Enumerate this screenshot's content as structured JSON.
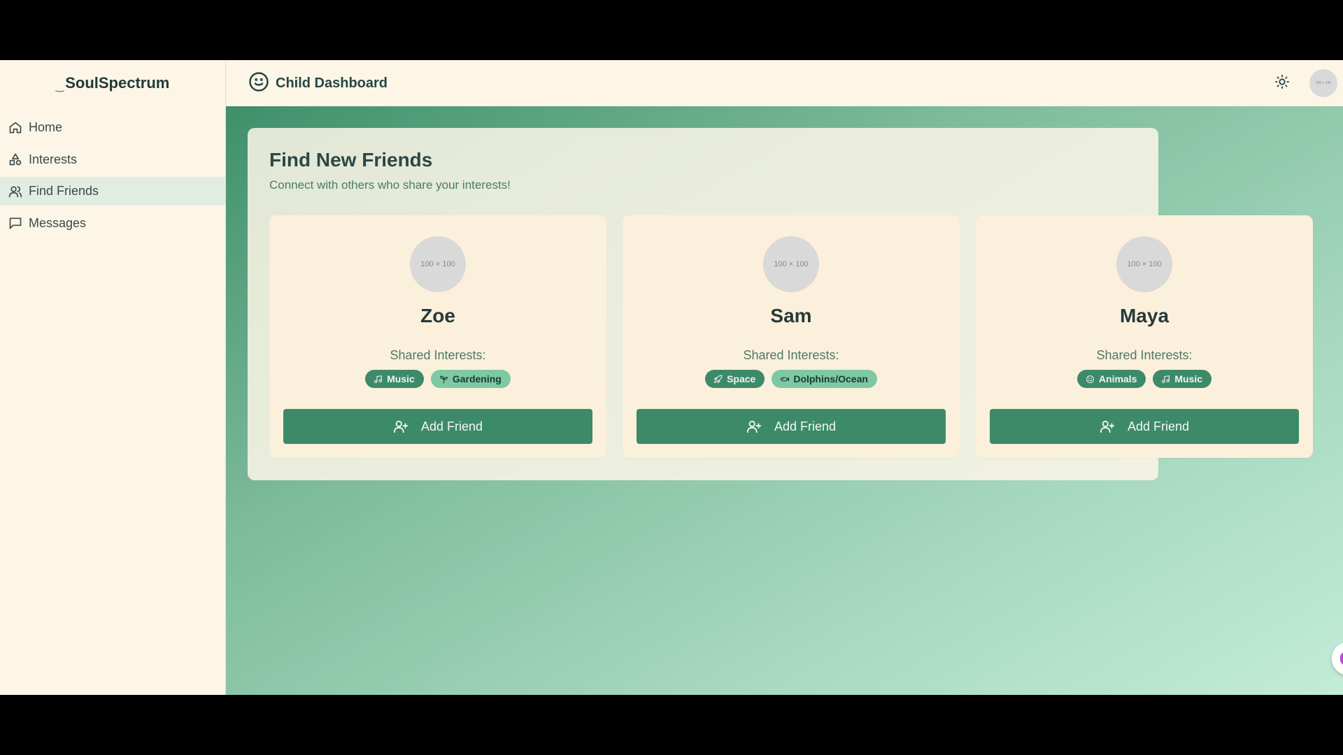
{
  "app": {
    "name": "SoulSpectrum"
  },
  "sidebar": {
    "items": [
      {
        "label": "Home",
        "icon": "home-icon"
      },
      {
        "label": "Interests",
        "icon": "shapes-icon"
      },
      {
        "label": "Find Friends",
        "icon": "users-icon",
        "active": true
      },
      {
        "label": "Messages",
        "icon": "message-square-icon"
      }
    ]
  },
  "header": {
    "title": "Child Dashboard",
    "avatar_placeholder": "100 × 100"
  },
  "page": {
    "title": "Find New Friends",
    "subtitle": "Connect with others who share your interests!"
  },
  "friends": [
    {
      "avatar": "100 × 100",
      "name": "Zoe",
      "shared_label": "Shared Interests:",
      "interests": [
        {
          "label": "Music",
          "icon": "music-note-icon"
        },
        {
          "label": "Gardening",
          "icon": "sprout-icon"
        }
      ],
      "button": "Add Friend"
    },
    {
      "avatar": "100 × 100",
      "name": "Sam",
      "shared_label": "Shared Interests:",
      "interests": [
        {
          "label": "Space",
          "icon": "rocket-icon"
        },
        {
          "label": "Dolphins/Ocean",
          "icon": "fish-icon"
        }
      ],
      "button": "Add Friend"
    },
    {
      "avatar": "100 × 100",
      "name": "Maya",
      "shared_label": "Shared Interests:",
      "interests": [
        {
          "label": "Animals",
          "icon": "paw-icon"
        },
        {
          "label": "Music",
          "icon": "music-note-icon"
        }
      ],
      "button": "Add Friend"
    }
  ],
  "colors": {
    "primary": "#3d8a6a",
    "tag_light": "#7ec8a4",
    "background": "#fdf6e6",
    "gradient_start": "#3f8f6b",
    "gradient_end": "#c3ecd8"
  }
}
